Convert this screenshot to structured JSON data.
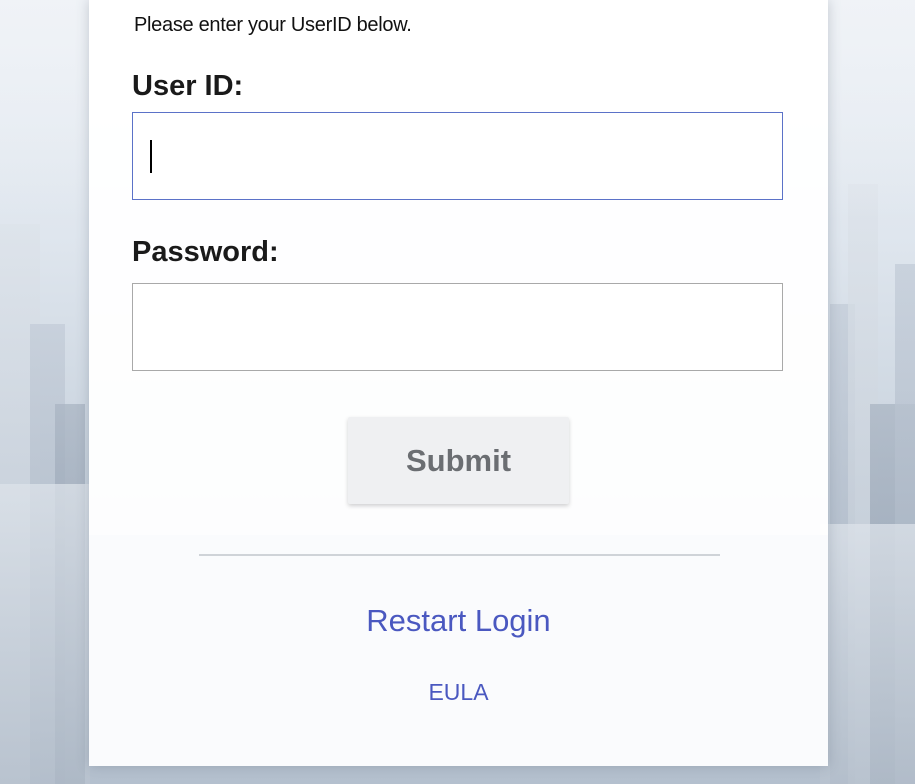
{
  "login": {
    "instructions": "Please enter your UserID below.",
    "userid_label": "User ID:",
    "userid_value": "",
    "password_label": "Password:",
    "password_value": "",
    "submit_label": "Submit",
    "restart_label": "Restart Login",
    "eula_label": "EULA"
  },
  "colors": {
    "link": "#4a58c0",
    "focus_border": "#5b72c8",
    "submit_bg": "#eff0f2",
    "submit_text": "#6b6e72"
  }
}
